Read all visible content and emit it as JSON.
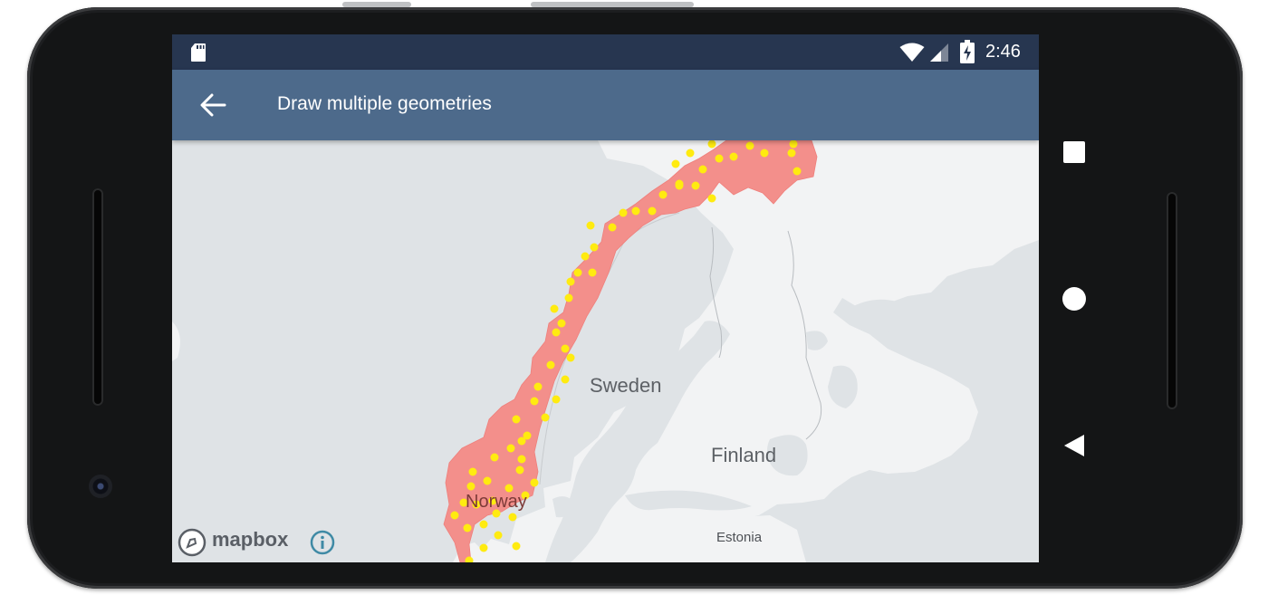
{
  "status_bar": {
    "time": "2:46",
    "icons": [
      "sd-card-icon",
      "wifi-icon",
      "signal-icon",
      "battery-charging-icon"
    ]
  },
  "app_bar": {
    "title": "Draw multiple geometries",
    "back_icon": "arrow-back-icon",
    "color": "#4d6a8b"
  },
  "map": {
    "labels": {
      "sweden": "Sweden",
      "finland": "Finland",
      "norway": "Norway",
      "estonia": "Estonia"
    },
    "attribution": {
      "logo_text": "mapbox",
      "info_icon": "info-icon"
    },
    "colors": {
      "water": "#dfe3e6",
      "land": "#f2f3f4",
      "polygon_fill": "#f38f8b",
      "point_color": "#ffeb10"
    }
  },
  "nav_bar": {
    "buttons": [
      "recents-square-icon",
      "home-circle-icon",
      "back-triangle-icon"
    ]
  }
}
